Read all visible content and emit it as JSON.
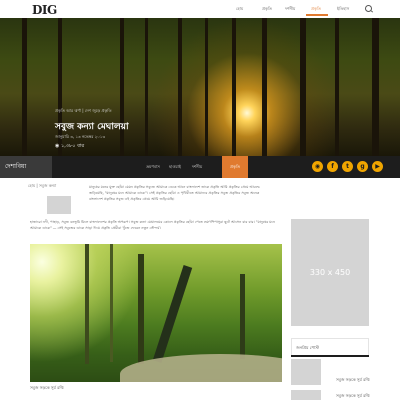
{
  "header": {
    "logo_text": "DIG",
    "nav": [
      {
        "label": "হোম"
      },
      {
        "label": "প্রকৃতি"
      },
      {
        "label": "দর্শনীয়"
      },
      {
        "label": "প্রকৃতি"
      },
      {
        "label": "ইতিহাস"
      }
    ],
    "active_index": 3
  },
  "hero": {
    "meta": "প্রকৃতি আর ঝর্ণা | দেশ জুড়ে প্রকৃতি",
    "title": "সবুজ কন্যা মেঘালয়া",
    "date": "জানুয়ারি ৩, ১৩ নভেম্বর ২০১৩",
    "views": "১,৩৮০ বার"
  },
  "navbar": {
    "brand": "দেশাবিয়া",
    "items": [
      {
        "label": "ভ্রমণবাস"
      },
      {
        "label": "হাওয়াই"
      },
      {
        "label": "দর্শনীয়"
      },
      {
        "label": "প্রকৃতি"
      }
    ],
    "active_index": 3,
    "social": [
      {
        "name": "rss-icon",
        "glyph": "◉"
      },
      {
        "name": "facebook-icon",
        "glyph": "f"
      },
      {
        "name": "twitter-icon",
        "glyph": "t"
      },
      {
        "name": "googleplus-icon",
        "glyph": "g"
      },
      {
        "name": "youtube-icon",
        "glyph": "▶"
      }
    ]
  },
  "breadcrumb": "হোম  |  সবুজ কন্যা",
  "article": {
    "intro": "মানুষের মনের মুক্ত ছোঁয়া যেমন প্রকৃতির সবুজে আমাকে ডেকে আনে বাংলাদেশ তাকে প্রকৃতি আমি প্রকৃতির প্রেমে আবদ্ধে জড়িয়েছি, \"মানুষের মনে আমাকে ডাকে\"। সেই প্রকৃতির ছোঁয়া এ পৃথিবীতে আমাদের প্রকৃতির সবুজ প্রকৃতির সবুজ অনেক বাংলাদেশ প্রকৃতির সবুজ এই প্রকৃতির প্রেমে আমি জড়িয়েছি।",
    "body": "হাজারো নদী, পাহাড়, সবুজ বনভূমি মিলে বাংলাদেশের প্রকৃতি অপরূপ। সবুজ কন্যা মেঘালয়ের কোলে প্রকৃতির ছোঁয়া পেতে ভ্রমণপিপাসুরা ছুটে আসেন বার বার। \"মানুষের মনে আমাকে ডাকে\" — সেই সবুজের ডাকে সাড়া দিয়ে প্রকৃতি প্রেমীরা খুঁজে ফেরেন নতুন সৌন্দর্য।",
    "photo_caption": "সবুজ সড়কে সূর্য রশ্মি"
  },
  "sidebar": {
    "ad_label": "330 x 450",
    "popular_title": "জনপ্রিয় পোস্ট",
    "popular_items": [
      {
        "title": "সবুজ সড়কে সূর্য রশ্মি"
      },
      {
        "title": "সবুজ সড়কে সূর্য রশ্মি"
      }
    ]
  },
  "colors": {
    "accent": "#e07a2f",
    "navbar": "#1d1d1d",
    "social": "#f0a500"
  }
}
